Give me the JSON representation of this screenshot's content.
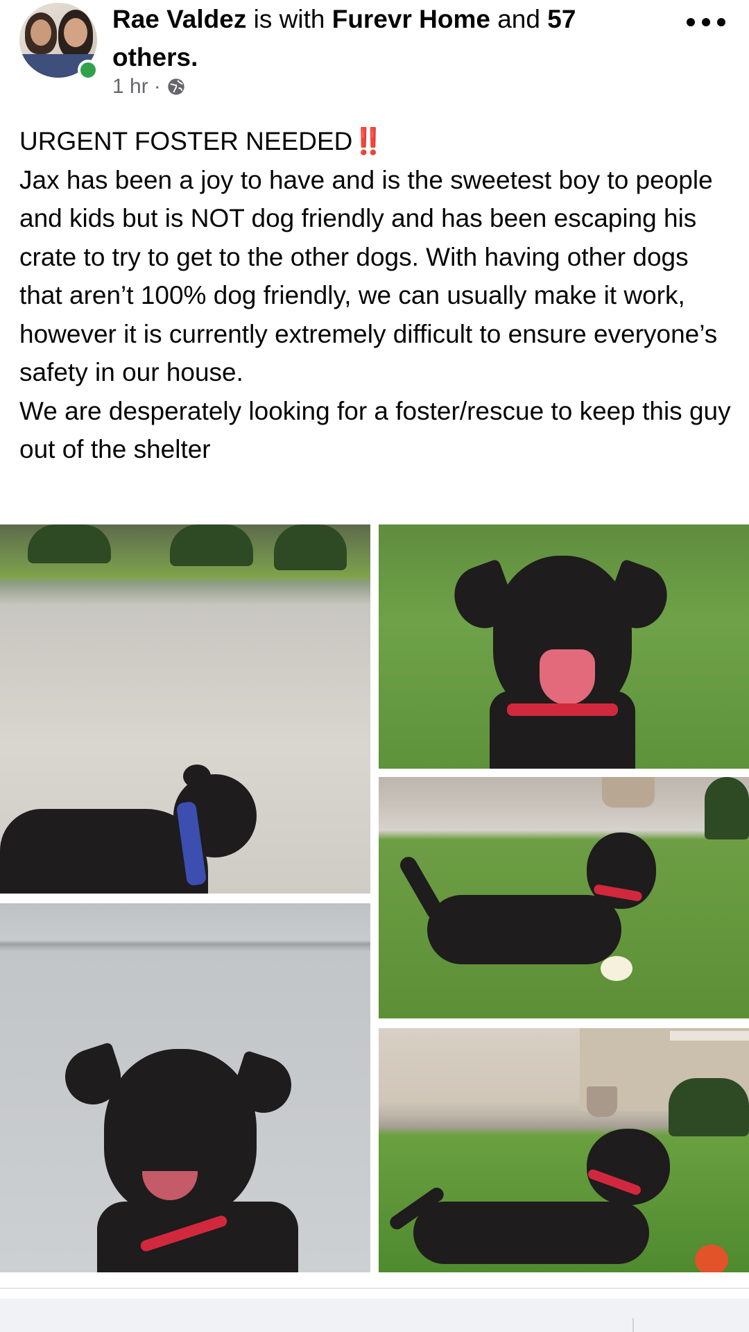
{
  "post": {
    "author_name": "Rae Valdez",
    "is_with": "is with",
    "tagged_page": "Furevr Home",
    "and": "and",
    "others_count": "57",
    "others_label": "others.",
    "timestamp": "1 hr",
    "separator": "·",
    "privacy_icon": "globe-icon",
    "more_icon": "more-options-icon",
    "online_status_color": "#31a24c",
    "body": {
      "headline": "URGENT FOSTER NEEDED",
      "headline_emoji": "‼️",
      "paragraph_1": "Jax has been a joy to have and is the sweetest boy to people and kids but is NOT dog friendly and has been escaping his crate to try to get to the other dogs. With having other dogs that aren’t 100% dog friendly, we can usually make it work, however it is currently extremely difficult to ensure everyone’s safety in our house.",
      "paragraph_2": "We are desperately looking for a foster/rescue to keep this guy out of the shelter"
    },
    "photos_count": 5
  }
}
